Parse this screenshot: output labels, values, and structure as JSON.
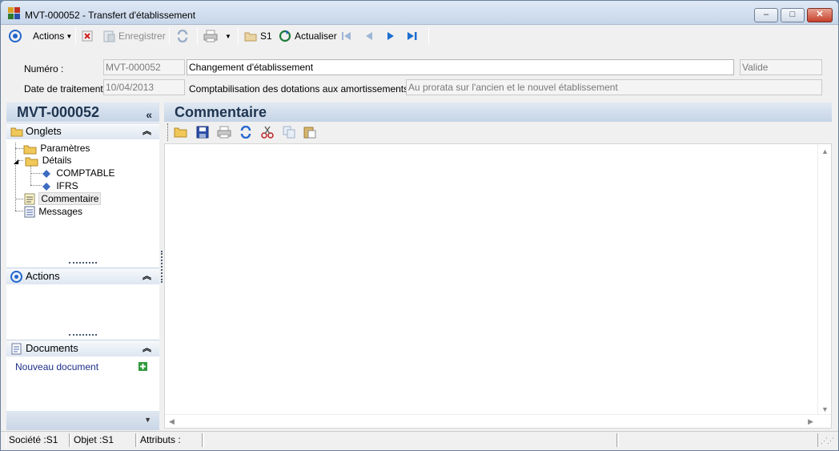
{
  "window": {
    "title": "MVT-000052 -  Transfert d'établissement",
    "minimize": "‒",
    "maximize": "□",
    "close": "✕"
  },
  "toolbar": {
    "actions_label": "Actions",
    "save_label": "Enregistrer",
    "s1_label": "S1",
    "refresh_label": "Actualiser"
  },
  "header": {
    "numero_label": "Numéro :",
    "numero_value": "MVT-000052",
    "description_value": "Changement d'établissement",
    "status_value": "Valide",
    "date_label": "Date de traitement :",
    "date_value": "10/04/2013",
    "comptabilisation_label": "Comptabilisation des dotations aux amortissements :",
    "comptabilisation_value": "Au prorata sur l'ancien et le nouvel établissement"
  },
  "left_panel": {
    "title": "MVT-000052",
    "collapse": "«",
    "onglets_label": "Onglets",
    "tree": {
      "parametres": "Paramètres",
      "details": "Détails",
      "comptable": "COMPTABLE",
      "ifrs": "IFRS",
      "commentaire": "Commentaire",
      "messages": "Messages"
    },
    "actions_label": "Actions",
    "documents_label": "Documents",
    "new_document": "Nouveau document"
  },
  "main": {
    "title": "Commentaire"
  },
  "statusbar": {
    "societe": "Société :S1",
    "objet": "Objet :S1",
    "attributs": "Attributs :"
  },
  "colors": {
    "panel_header_text": "#1f3550",
    "link": "#1c2f8a",
    "accent_blue": "#1f5fbf"
  }
}
